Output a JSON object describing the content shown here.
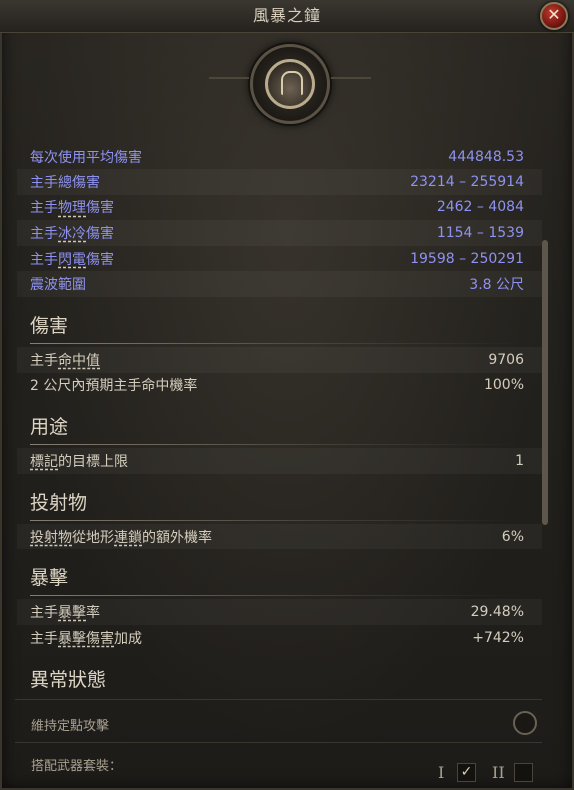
{
  "window": {
    "title": "風暴之鐘",
    "close_label": "✕"
  },
  "emblem": {
    "icon": "bell-emblem-icon"
  },
  "stats_top": [
    {
      "label": "每次使用平均傷害",
      "value": "444848.53"
    },
    {
      "label": "主手總傷害",
      "value_min": "23214",
      "value_max": "255914"
    },
    {
      "label_pre": "主手",
      "label_u": "物理",
      "label_post": "傷害",
      "value_min": "2462",
      "value_max": "4084"
    },
    {
      "label_pre": "主手",
      "label_u": "冰冷",
      "label_post": "傷害",
      "value_min": "1154",
      "value_max": "1539"
    },
    {
      "label_pre": "主手",
      "label_u": "閃電",
      "label_post": "傷害",
      "value_min": "19598",
      "value_max": "250291"
    },
    {
      "label": "震波範圍",
      "value": "3.8 公尺"
    }
  ],
  "sections": {
    "damage": {
      "title": "傷害",
      "rows": [
        {
          "label_pre": "主手",
          "label_u": "命中值",
          "label_post": "",
          "value": "9706"
        },
        {
          "label": "2 公尺內預期主手命中機率",
          "value": "100%"
        }
      ]
    },
    "usage": {
      "title": "用途",
      "rows": [
        {
          "label_pre": "",
          "label_u": "標記",
          "label_post": "的目標上限",
          "value": "1"
        }
      ]
    },
    "projectile": {
      "title": "投射物",
      "rows": [
        {
          "label_pre": "",
          "label_u": "投射物",
          "label_post": "從地形",
          "label_u2": "連鎖",
          "label_post2": "的額外機率",
          "value": "6%"
        }
      ]
    },
    "crit": {
      "title": "暴擊",
      "rows": [
        {
          "label_pre": "主手",
          "label_u": "暴擊",
          "label_post": "率",
          "value": "29.48%"
        },
        {
          "label_pre": "主手",
          "label_u": "暴擊傷害",
          "label_post": "加成",
          "value": "+742%"
        }
      ]
    },
    "status": {
      "title": "異常狀態"
    }
  },
  "footer": {
    "hold_position_label": "維持定點攻擊",
    "weapon_set_label": "搭配武器套裝：",
    "set_one_label": "I",
    "set_two_label": "II",
    "set_one_check": "✓"
  },
  "colors": {
    "blue_stat": "#8e92f0",
    "accent_red": "#c0382d"
  }
}
